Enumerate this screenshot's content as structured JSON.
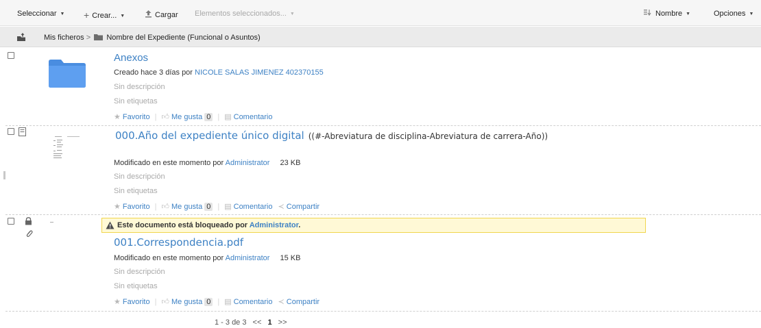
{
  "toolbar": {
    "select_label": "Seleccionar",
    "create_label": "Crear...",
    "upload_label": "Cargar",
    "selected_items_label": "Elementos seleccionados...",
    "sort_label": "Nombre",
    "options_label": "Opciones"
  },
  "breadcrumb": {
    "root": "Mis ficheros",
    "separator": ">",
    "current": "Nombre del Expediente (Funcional o Asuntos)"
  },
  "items": [
    {
      "name": "Anexos",
      "meta_prefix": "Creado hace 3 días por",
      "author": "NICOLE SALAS JIMENEZ 402370155",
      "description": "Sin descripción",
      "tags": "Sin etiquetas",
      "favorite_label": "Favorito",
      "like_label": "Me gusta",
      "like_count": "0",
      "comment_label": "Comentario"
    },
    {
      "name": "000.Año del expediente único digital",
      "name_suffix": "((#-Abreviatura de disciplina-Abreviatura de carrera-Año))",
      "meta_prefix": "Modificado en este momento por",
      "author": "Administrator",
      "size": "23 KB",
      "description": "Sin descripción",
      "tags": "Sin etiquetas",
      "favorite_label": "Favorito",
      "like_label": "Me gusta",
      "like_count": "0",
      "comment_label": "Comentario",
      "share_label": "Compartir"
    },
    {
      "lock_notice_prefix": "Este documento está bloqueado por",
      "lock_owner": "Administrator",
      "lock_notice_suffix": ".",
      "name": "001.Correspondencia.pdf",
      "meta_prefix": "Modificado en este momento por",
      "author": "Administrator",
      "size": "15 KB",
      "description": "Sin descripción",
      "tags": "Sin etiquetas",
      "favorite_label": "Favorito",
      "like_label": "Me gusta",
      "like_count": "0",
      "comment_label": "Comentario",
      "share_label": "Compartir"
    }
  ],
  "pagination": {
    "range": "1 - 3 de 3",
    "prev": "<<",
    "current_page": "1",
    "next": ">>"
  },
  "colors": {
    "link": "#3d81c4",
    "folder": "#5b9ee9",
    "lock_notice_bg": "#fff9d6",
    "lock_notice_border": "#f0d54d"
  }
}
